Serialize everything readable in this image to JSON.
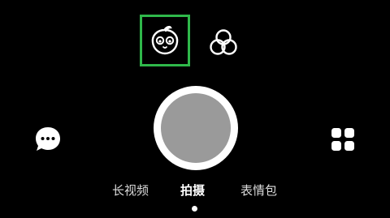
{
  "filters": {
    "face_icon": "face-icon",
    "circles_icon": "overlapping-circles-icon",
    "selected_border_color": "#2fb84a"
  },
  "capture": {
    "shutter_icon": "shutter-button",
    "shutter_ring_color": "#ffffff",
    "shutter_fill_color": "#9a9a9a"
  },
  "side_actions": {
    "left_icon": "chat-bubble-icon",
    "right_icon": "grid-icon"
  },
  "modes": {
    "items": [
      {
        "label": "长视频",
        "active": false
      },
      {
        "label": "拍摄",
        "active": true
      },
      {
        "label": "表情包",
        "active": false
      }
    ],
    "active_index": 1
  }
}
